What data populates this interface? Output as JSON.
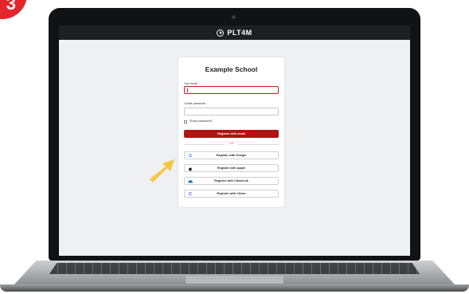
{
  "step": {
    "number": "3"
  },
  "topbar": {
    "brand": "PLT4M"
  },
  "card": {
    "title": "Example School",
    "email_label": "Your email",
    "email_value": "",
    "password_label": "Create password",
    "password_value": "",
    "show_password_label": "Show password?",
    "register_email_label": "Register with email",
    "or_label": "OR",
    "sso": [
      {
        "label": "Register with Google",
        "icon": "google-icon"
      },
      {
        "label": "Register with Apple",
        "icon": "apple-icon"
      },
      {
        "label": "Register with ClassLink",
        "icon": "classlink-icon"
      },
      {
        "label": "Register with Clever",
        "icon": "clever-icon"
      }
    ]
  },
  "colors": {
    "primary": "#b01412",
    "step_badge": "#e3262b",
    "arrow": "#f5c842",
    "topbar": "#1d1f22"
  }
}
